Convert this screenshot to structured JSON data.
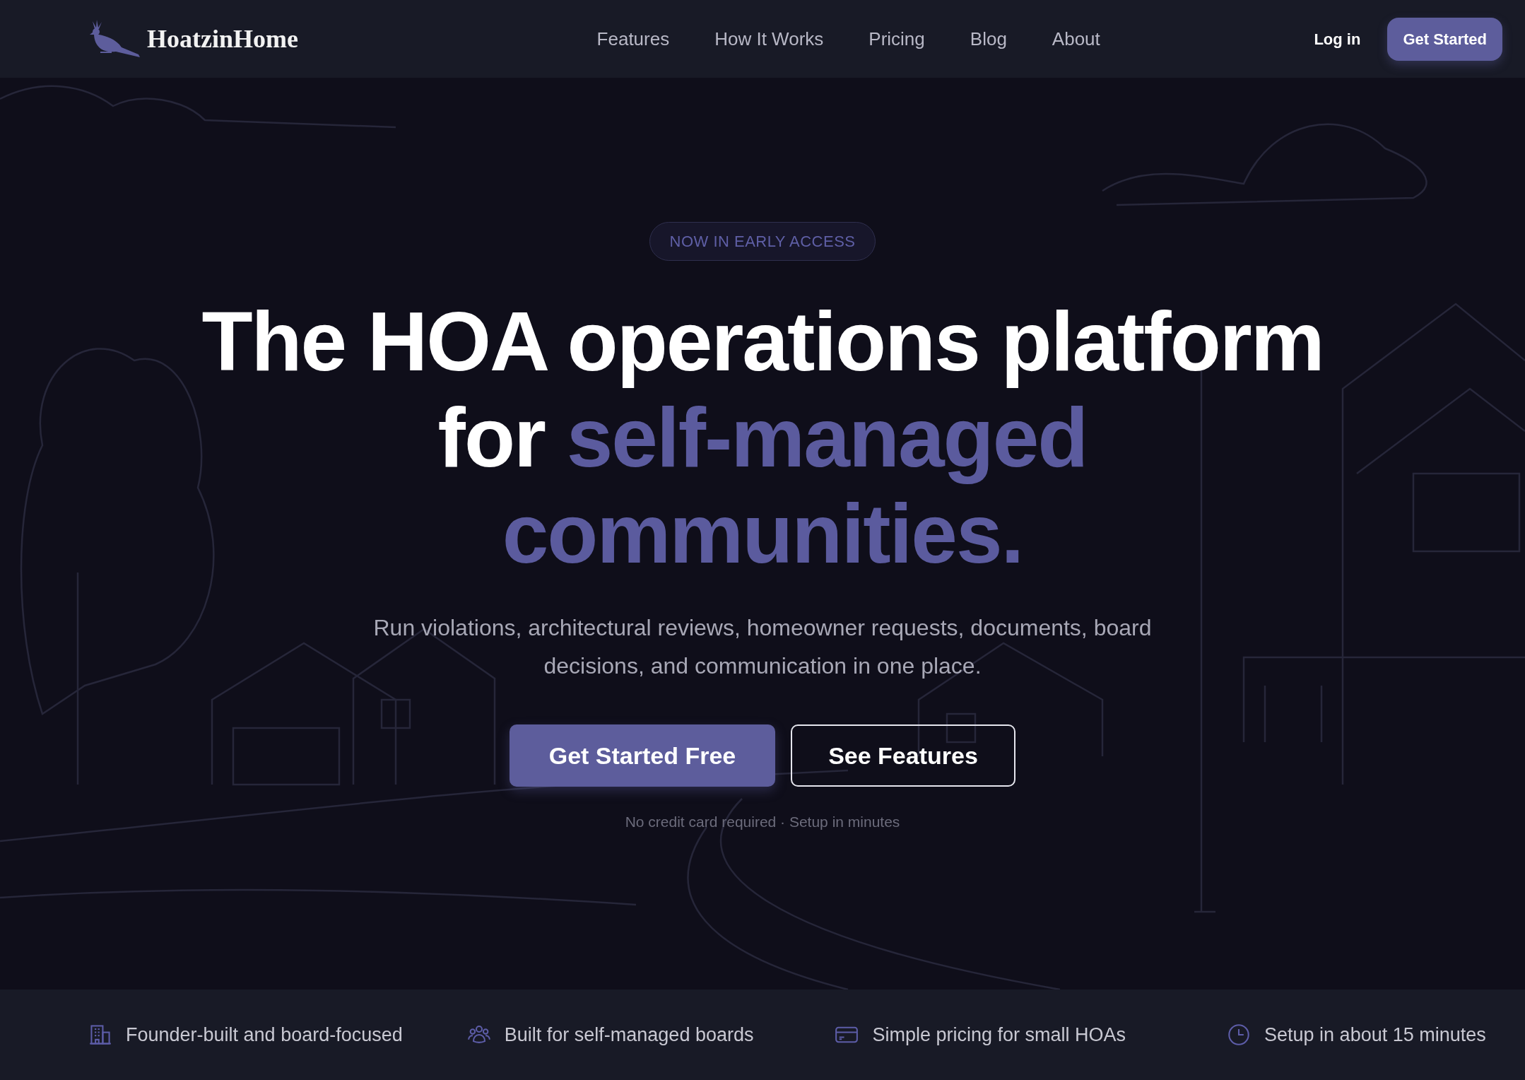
{
  "navbar": {
    "brand": "HoatzinHome",
    "links": [
      {
        "label": "Features"
      },
      {
        "label": "How It Works"
      },
      {
        "label": "Pricing"
      },
      {
        "label": "Blog"
      },
      {
        "label": "About"
      }
    ],
    "login": "Log in",
    "cta": "Get Started"
  },
  "hero": {
    "badge": "NOW IN EARLY ACCESS",
    "headline": [
      [
        {
          "text": "The HOA operations platform",
          "accent": false
        }
      ],
      [
        {
          "text": "for ",
          "accent": false
        },
        {
          "text": "self-managed",
          "accent": true
        }
      ],
      [
        {
          "text": "communities.",
          "accent": true
        }
      ]
    ],
    "subtitle": "Run violations, architectural reviews, homeowner requests, documents, board decisions, and communication in one place.",
    "buttons": [
      {
        "label": "Get Started Free",
        "kind": "primary"
      },
      {
        "label": "See Features",
        "kind": "outline"
      }
    ],
    "note": "No credit card required · Setup in minutes"
  },
  "highlights": [
    {
      "label": "Founder-built and board-focused"
    },
    {
      "label": "Built for self-managed boards"
    },
    {
      "label": "Simple pricing for small HOAs"
    },
    {
      "label": "Setup in about 15 minutes"
    }
  ]
}
